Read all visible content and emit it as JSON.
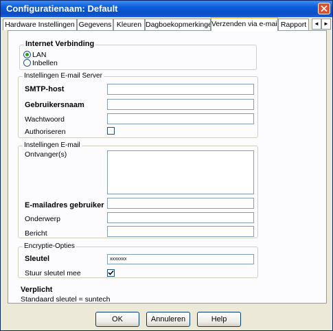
{
  "window": {
    "title": "Configuratienaam: Default"
  },
  "tabs": [
    {
      "label": "Hardware Instellingen"
    },
    {
      "label": "Gegevens"
    },
    {
      "label": "Kleuren"
    },
    {
      "label": "Dagboekopmerkingen"
    },
    {
      "label": "Verzenden via e-mail",
      "active": true
    },
    {
      "label": "Rapport"
    }
  ],
  "tab_scroll": {
    "left": "◄",
    "right": "►"
  },
  "internet": {
    "title": "Internet Verbinding",
    "options": [
      {
        "label": "LAN",
        "selected": true
      },
      {
        "label": "Inbellen",
        "selected": false
      }
    ]
  },
  "server": {
    "title": "Instellingen E-mail Server",
    "smtp_label": "SMTP-host",
    "smtp_value": "",
    "user_label": "Gebruikersnaam",
    "user_value": "",
    "password_label": "Wachtwoord",
    "password_value": "",
    "auth_label": "Authoriseren",
    "auth_checked": false
  },
  "email": {
    "title": "Instellingen E-mail",
    "recipients_label": "Ontvanger(s)",
    "recipients_value": "",
    "sender_label": "E-mailadres gebruiker",
    "sender_value": "",
    "subject_label": "Onderwerp",
    "subject_value": "",
    "message_label": "Bericht",
    "message_value": ""
  },
  "encryption": {
    "title": "Encryptie-Opties",
    "key_label": "Sleutel",
    "key_value": "xxxxxxx",
    "send_key_label": "Stuur sleutel mee",
    "send_key_checked": true
  },
  "note": {
    "title": "Verplicht",
    "text": "Standaard sleutel = suntech"
  },
  "buttons": {
    "ok": "OK",
    "cancel": "Annuleren",
    "help": "Help"
  },
  "colors": {
    "titlebar": "#0b5bd9",
    "close": "#e0502c",
    "radio_dot": "#21a121",
    "active_tab_accent": "#ffc83c"
  }
}
